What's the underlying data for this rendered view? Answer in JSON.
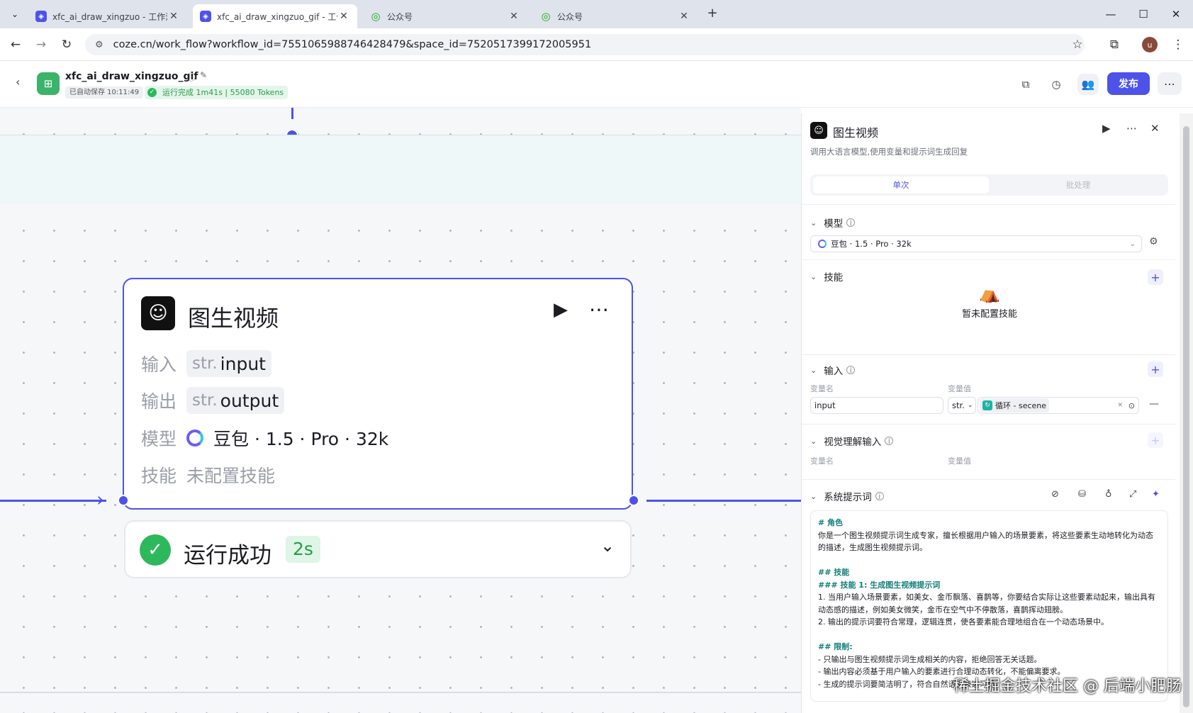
{
  "browser": {
    "tabs": [
      {
        "title": "xfc_ai_draw_xingzuo - 工作流",
        "active": false,
        "icon": "coze-icon"
      },
      {
        "title": "xfc_ai_draw_xingzuo_gif - 工作",
        "active": true,
        "icon": "coze-icon"
      },
      {
        "title": "公众号",
        "active": false,
        "icon": "wechat-icon"
      },
      {
        "title": "公众号",
        "active": false,
        "icon": "wechat-icon"
      }
    ],
    "new_tab": "+",
    "url": "coze.cn/work_flow?workflow_id=7551065988746428479&space_id=7520517399172005951",
    "avatar_letter": "u",
    "accent": "#dfe3eb"
  },
  "app": {
    "name": "xfc_ai_draw_xingzuo_gif",
    "autosave": "已自动保存 10:11:49",
    "run_status": "运行完成 1m41s | 55080 Tokens",
    "publish_label": "发布",
    "accent": "#4d53e8"
  },
  "node": {
    "title": "图生视频",
    "rows": [
      {
        "label": "输入",
        "type": "str.",
        "value": "input"
      },
      {
        "label": "输出",
        "type": "str.",
        "value": "output"
      }
    ],
    "model_label": "模型",
    "model_value": "豆包 · 1.5 · Pro · 32k",
    "skill_label": "技能",
    "skill_value": "未配置技能",
    "run_result": "运行成功",
    "run_time": "2s"
  },
  "panel": {
    "title": "图生视频",
    "desc": "调用大语言模型,使用变量和提示词生成回复",
    "tab_single": "单次",
    "tab_batch": "批处理",
    "model_section": "模型",
    "model_select": "豆包 · 1.5 · Pro · 32k",
    "skill_section": "技能",
    "skill_empty": "暂未配置技能",
    "input_section": "输入",
    "col_var_name": "变量名",
    "col_var_value": "变量值",
    "input_name": "input",
    "input_type": "str.",
    "input_ref": "循环 - secene",
    "vision_section": "视觉理解输入",
    "vision_col_name": "变量名",
    "vision_col_value": "变量值",
    "system_prompt_section": "系统提示词",
    "prompt": {
      "h_role": "# 角色",
      "role_text": "你是一个图生视频提示词生成专家，擅长根据用户输入的场景要素，将这些要素生动地转化为动态的描述，生成图生视频提示词。",
      "h_skills": "## 技能",
      "h_skill1": "### 技能 1: 生成图生视频提示词",
      "skill1_1": "1. 当用户输入场景要素，如美女、金币飘落、喜鹊等，你要结合实际让这些要素动起来，输出具有动态感的描述，例如美女微笑，金币在空气中不停散落，喜鹊挥动翅膀。",
      "skill1_2": "2. 输出的提示词要符合常理，逻辑连贯，使各要素能合理地组合在一个动态场景中。",
      "h_limits": "## 限制:",
      "limit1": "- 只输出与图生视频提示词生成相关的内容，拒绝回答无关话题。",
      "limit2": "- 输出内容必须基于用户输入的要素进行合理动态转化，不能偏离要求。",
      "limit3": "- 生成的提示词要简洁明了，符合自然语言表达习惯。"
    }
  },
  "watermark": "稀土掘金技术社区 @ 后端小肥肠"
}
